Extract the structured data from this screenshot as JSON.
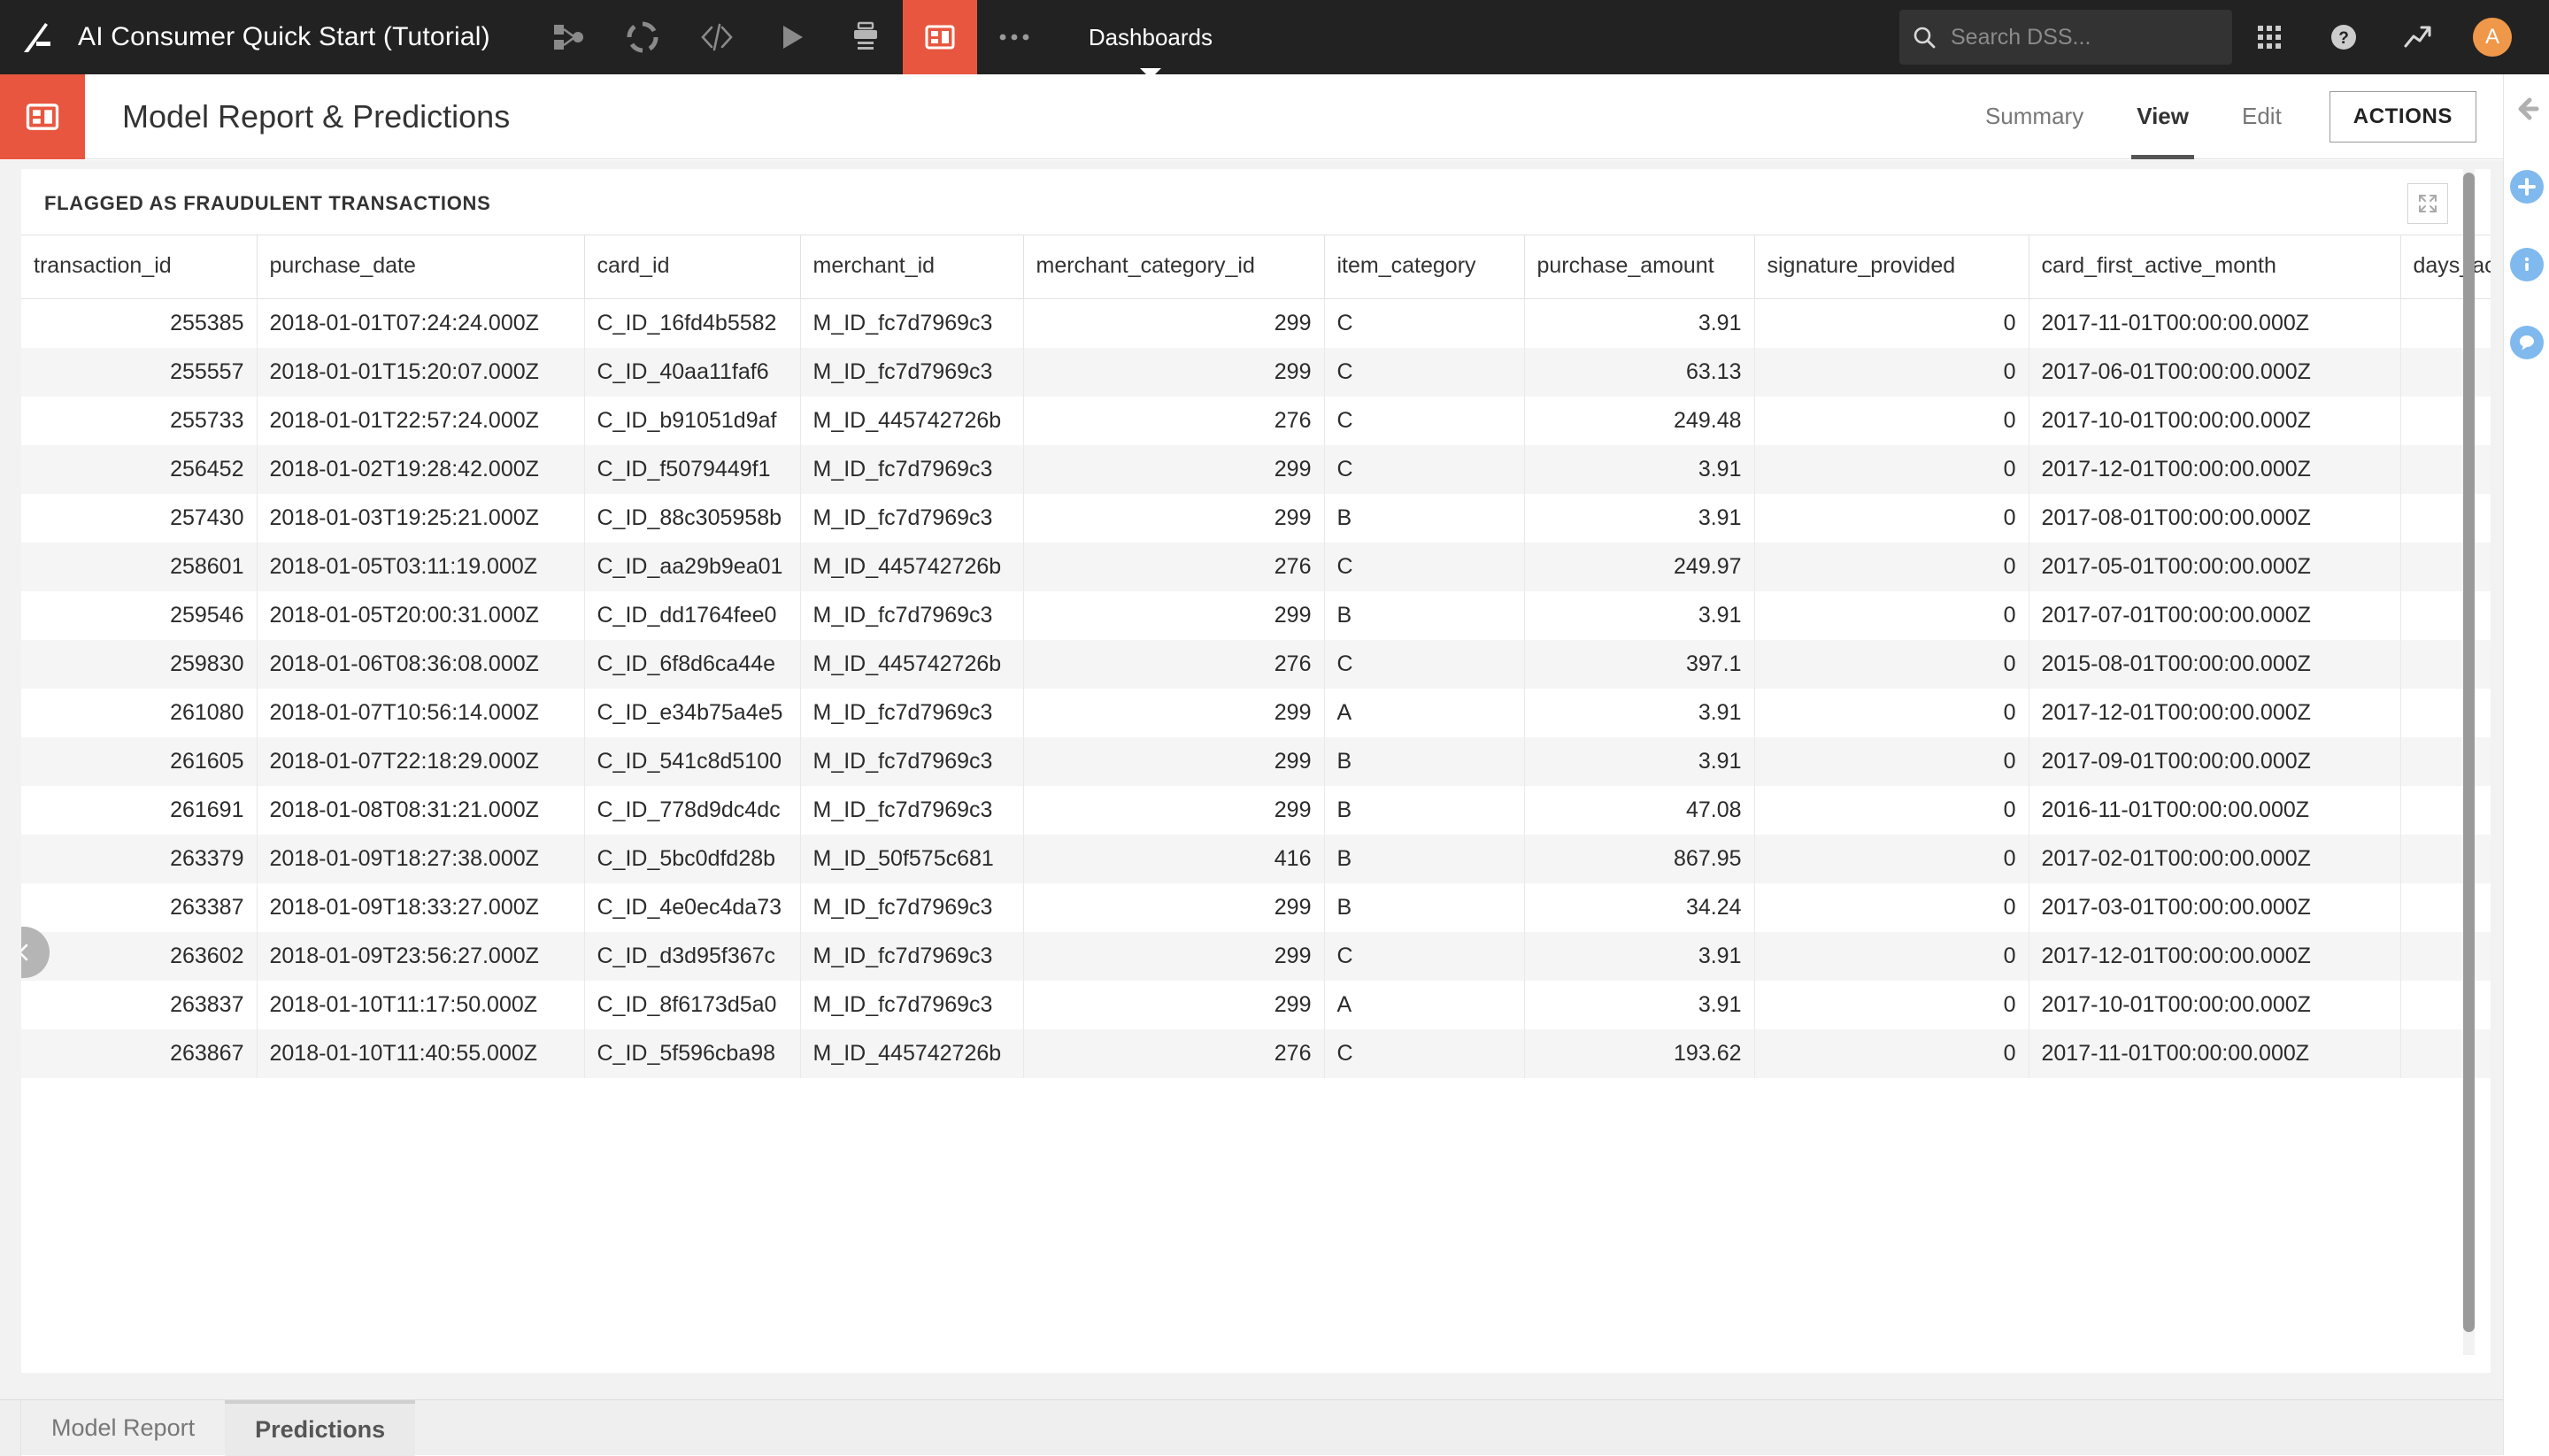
{
  "topbar": {
    "logo_icon": "dataiku-logo-icon",
    "project_title": "AI Consumer Quick Start (Tutorial)",
    "icons": [
      {
        "name": "flow-icon",
        "label": "Flow"
      },
      {
        "name": "lab-icon",
        "label": "Lab"
      },
      {
        "name": "code-icon",
        "label": "Code"
      },
      {
        "name": "jobs-run-icon",
        "label": "Jobs"
      },
      {
        "name": "automation-icon",
        "label": "Automation"
      },
      {
        "name": "dashboards-icon",
        "label": "Dashboards",
        "active": true
      },
      {
        "name": "more-icon",
        "label": "More"
      }
    ],
    "nav_label": "Dashboards",
    "search": {
      "placeholder": "Search DSS...",
      "value": "",
      "icon": "search-icon"
    },
    "apps_icon": "apps-grid-icon",
    "help_icon": "help-question-icon",
    "metrics_icon": "trending-up-icon",
    "avatar_initial": "A"
  },
  "subheader": {
    "icon": "dashboard-icon",
    "title": "Model Report & Predictions",
    "tabs": [
      {
        "label": "Summary",
        "active": false
      },
      {
        "label": "View",
        "active": true
      },
      {
        "label": "Edit",
        "active": false
      }
    ],
    "actions_label": "ACTIONS",
    "collapse_icon": "arrow-left-icon"
  },
  "right_rail": {
    "buttons": [
      {
        "name": "add-insight-button",
        "icon": "plus-icon"
      },
      {
        "name": "details-button",
        "icon": "info-icon"
      },
      {
        "name": "discussions-button",
        "icon": "chat-bubble-icon"
      }
    ]
  },
  "tile": {
    "title": "FLAGGED AS FRAUDULENT TRANSACTIONS",
    "expand_icon": "expand-arrows-icon",
    "pager_icon": "chevron-left-icon"
  },
  "table": {
    "columns": [
      {
        "key": "transaction_id",
        "label": "transaction_id",
        "align": "right"
      },
      {
        "key": "purchase_date",
        "label": "purchase_date",
        "align": "left"
      },
      {
        "key": "card_id",
        "label": "card_id",
        "align": "left"
      },
      {
        "key": "merchant_id",
        "label": "merchant_id",
        "align": "left"
      },
      {
        "key": "merchant_category_id",
        "label": "merchant_category_id",
        "align": "right"
      },
      {
        "key": "item_category",
        "label": "item_category",
        "align": "left"
      },
      {
        "key": "purchase_amount",
        "label": "purchase_amount",
        "align": "right"
      },
      {
        "key": "signature_provided",
        "label": "signature_provided",
        "align": "right"
      },
      {
        "key": "card_first_active_month",
        "label": "card_first_active_month",
        "align": "left"
      },
      {
        "key": "days_act",
        "label": "days_act",
        "align": "left"
      }
    ],
    "rows": [
      [
        "255385",
        "2018-01-01T07:24:24.000Z",
        "C_ID_16fd4b5582",
        "M_ID_fc7d7969c3",
        "299",
        "C",
        "3.91",
        "0",
        "2017-11-01T00:00:00.000Z",
        ""
      ],
      [
        "255557",
        "2018-01-01T15:20:07.000Z",
        "C_ID_40aa11faf6",
        "M_ID_fc7d7969c3",
        "299",
        "C",
        "63.13",
        "0",
        "2017-06-01T00:00:00.000Z",
        ""
      ],
      [
        "255733",
        "2018-01-01T22:57:24.000Z",
        "C_ID_b91051d9af",
        "M_ID_445742726b",
        "276",
        "C",
        "249.48",
        "0",
        "2017-10-01T00:00:00.000Z",
        ""
      ],
      [
        "256452",
        "2018-01-02T19:28:42.000Z",
        "C_ID_f5079449f1",
        "M_ID_fc7d7969c3",
        "299",
        "C",
        "3.91",
        "0",
        "2017-12-01T00:00:00.000Z",
        ""
      ],
      [
        "257430",
        "2018-01-03T19:25:21.000Z",
        "C_ID_88c305958b",
        "M_ID_fc7d7969c3",
        "299",
        "B",
        "3.91",
        "0",
        "2017-08-01T00:00:00.000Z",
        ""
      ],
      [
        "258601",
        "2018-01-05T03:11:19.000Z",
        "C_ID_aa29b9ea01",
        "M_ID_445742726b",
        "276",
        "C",
        "249.97",
        "0",
        "2017-05-01T00:00:00.000Z",
        ""
      ],
      [
        "259546",
        "2018-01-05T20:00:31.000Z",
        "C_ID_dd1764fee0",
        "M_ID_fc7d7969c3",
        "299",
        "B",
        "3.91",
        "0",
        "2017-07-01T00:00:00.000Z",
        ""
      ],
      [
        "259830",
        "2018-01-06T08:36:08.000Z",
        "C_ID_6f8d6ca44e",
        "M_ID_445742726b",
        "276",
        "C",
        "397.1",
        "0",
        "2015-08-01T00:00:00.000Z",
        ""
      ],
      [
        "261080",
        "2018-01-07T10:56:14.000Z",
        "C_ID_e34b75a4e5",
        "M_ID_fc7d7969c3",
        "299",
        "A",
        "3.91",
        "0",
        "2017-12-01T00:00:00.000Z",
        ""
      ],
      [
        "261605",
        "2018-01-07T22:18:29.000Z",
        "C_ID_541c8d5100",
        "M_ID_fc7d7969c3",
        "299",
        "B",
        "3.91",
        "0",
        "2017-09-01T00:00:00.000Z",
        ""
      ],
      [
        "261691",
        "2018-01-08T08:31:21.000Z",
        "C_ID_778d9dc4dc",
        "M_ID_fc7d7969c3",
        "299",
        "B",
        "47.08",
        "0",
        "2016-11-01T00:00:00.000Z",
        ""
      ],
      [
        "263379",
        "2018-01-09T18:27:38.000Z",
        "C_ID_5bc0dfd28b",
        "M_ID_50f575c681",
        "416",
        "B",
        "867.95",
        "0",
        "2017-02-01T00:00:00.000Z",
        ""
      ],
      [
        "263387",
        "2018-01-09T18:33:27.000Z",
        "C_ID_4e0ec4da73",
        "M_ID_fc7d7969c3",
        "299",
        "B",
        "34.24",
        "0",
        "2017-03-01T00:00:00.000Z",
        ""
      ],
      [
        "263602",
        "2018-01-09T23:56:27.000Z",
        "C_ID_d3d95f367c",
        "M_ID_fc7d7969c3",
        "299",
        "C",
        "3.91",
        "0",
        "2017-12-01T00:00:00.000Z",
        ""
      ],
      [
        "263837",
        "2018-01-10T11:17:50.000Z",
        "C_ID_8f6173d5a0",
        "M_ID_fc7d7969c3",
        "299",
        "A",
        "3.91",
        "0",
        "2017-10-01T00:00:00.000Z",
        ""
      ],
      [
        "263867",
        "2018-01-10T11:40:55.000Z",
        "C_ID_5f596cba98",
        "M_ID_445742726b",
        "276",
        "C",
        "193.62",
        "0",
        "2017-11-01T00:00:00.000Z",
        ""
      ]
    ]
  },
  "bottom_tabs": [
    {
      "label": "Model Report",
      "active": false
    },
    {
      "label": "Predictions",
      "active": true
    }
  ],
  "colors": {
    "brand_red": "#e8563f",
    "topbar_bg": "#222222",
    "avatar_orange": "#f0984a",
    "rail_blue": "#7fb9ee"
  }
}
